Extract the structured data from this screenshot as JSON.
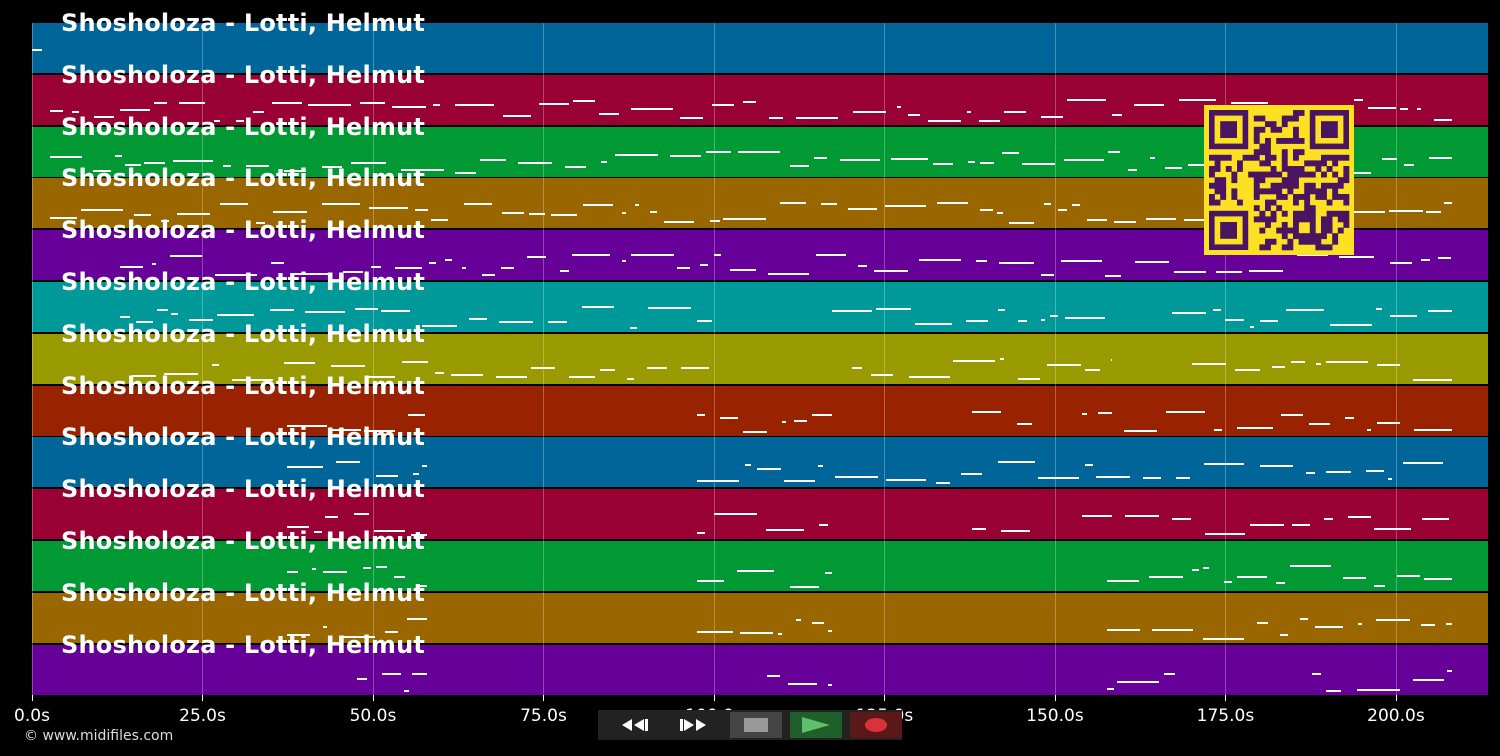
{
  "song_title": "Shosholoza - Lotti, Helmut",
  "tracks": [
    {
      "title": "Shosholoza - Lotti, Helmut",
      "color": "#006699"
    },
    {
      "title": "Shosholoza - Lotti, Helmut",
      "color": "#990033"
    },
    {
      "title": "Shosholoza - Lotti, Helmut",
      "color": "#009933"
    },
    {
      "title": "Shosholoza - Lotti, Helmut",
      "color": "#996600"
    },
    {
      "title": "Shosholoza - Lotti, Helmut",
      "color": "#660099"
    },
    {
      "title": "Shosholoza - Lotti, Helmut",
      "color": "#009999"
    },
    {
      "title": "Shosholoza - Lotti, Helmut",
      "color": "#999900"
    },
    {
      "title": "Shosholoza - Lotti, Helmut",
      "color": "#992200"
    },
    {
      "title": "Shosholoza - Lotti, Helmut",
      "color": "#006699"
    },
    {
      "title": "Shosholoza - Lotti, Helmut",
      "color": "#990033"
    },
    {
      "title": "Shosholoza - Lotti, Helmut",
      "color": "#009933"
    },
    {
      "title": "Shosholoza - Lotti, Helmut",
      "color": "#996600"
    },
    {
      "title": "Shosholoza - Lotti, Helmut",
      "color": "#660099"
    }
  ],
  "time_axis": {
    "ticks": [
      "0.0s",
      "25.0s",
      "50.0s",
      "75.0s",
      "100.0s",
      "125.0s",
      "150.0s",
      "175.0s",
      "200.0s"
    ],
    "max_seconds": 213.5
  },
  "copyright": "© www.midifiles.com",
  "controls": {
    "rewind": "rewind-icon",
    "fast_forward": "fast-forward-icon",
    "stop": "stop-icon",
    "play": "play-icon",
    "record": "record-icon"
  },
  "qr_code": {
    "color_fg": "#4a1560",
    "color_bg": "#fbe122"
  }
}
